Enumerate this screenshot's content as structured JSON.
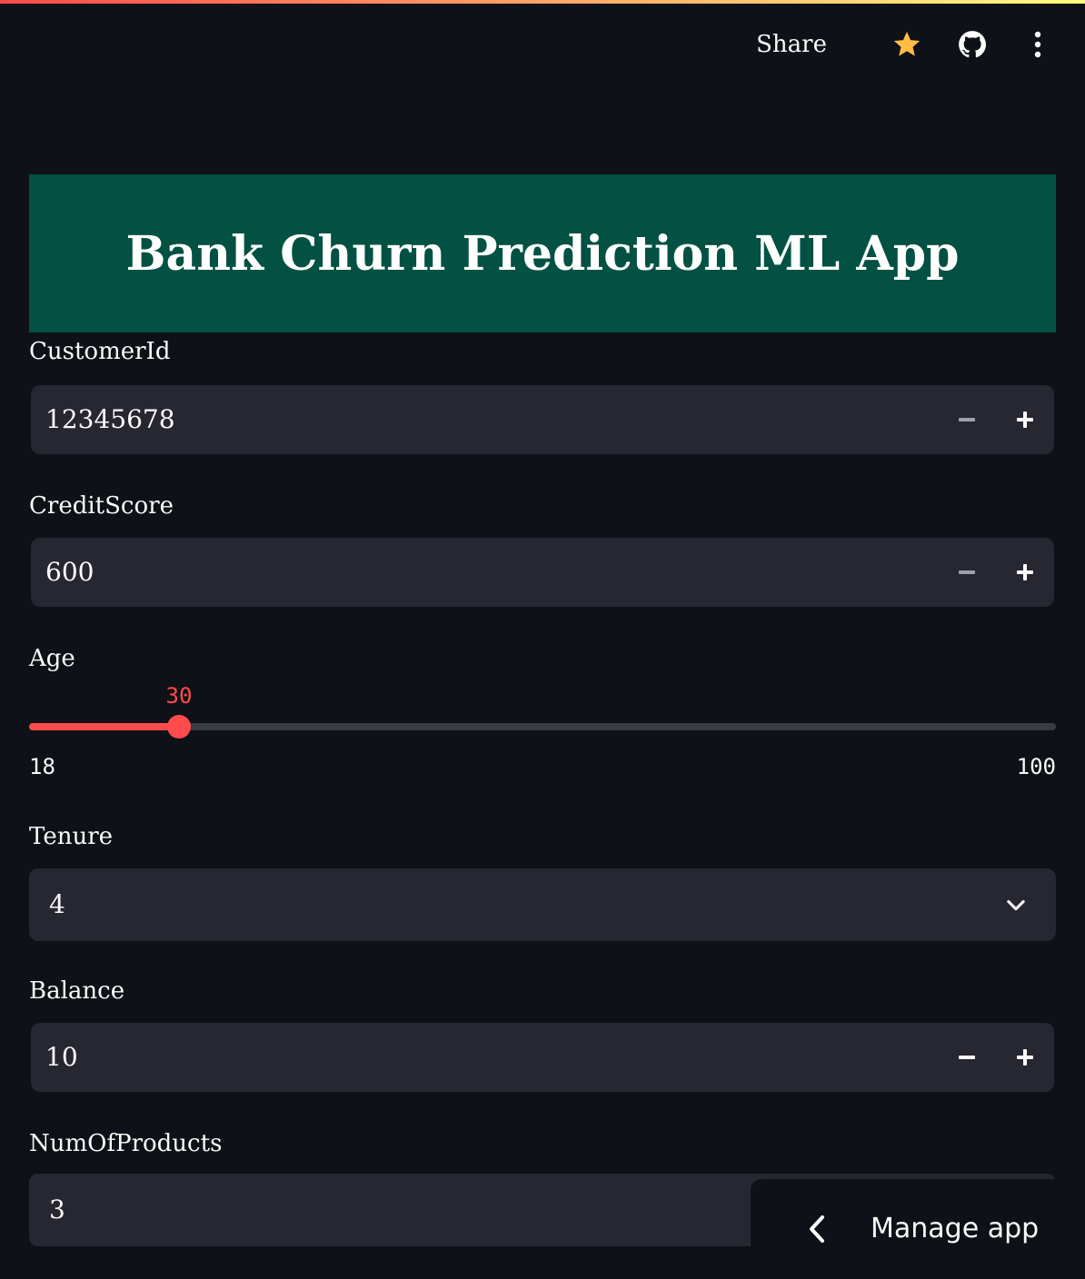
{
  "header": {
    "share_label": "Share",
    "icons": [
      "star-icon",
      "github-icon",
      "kebab-menu-icon"
    ],
    "accent_star": "#ffbd45"
  },
  "banner": {
    "title": "Bank Churn Prediction ML App",
    "background": "#025143"
  },
  "fields": {
    "customer_id": {
      "label": "CustomerId",
      "value": "12345678"
    },
    "credit_score": {
      "label": "CreditScore",
      "value": "600"
    },
    "age": {
      "label": "Age",
      "value": 30,
      "value_text": "30",
      "min": 18,
      "min_text": "18",
      "max": 100,
      "max_text": "100"
    },
    "tenure": {
      "label": "Tenure",
      "value": "4"
    },
    "balance": {
      "label": "Balance",
      "value": "10"
    },
    "num_of_products": {
      "label": "NumOfProducts",
      "value": "3"
    }
  },
  "manage_app": {
    "label": "Manage app"
  },
  "colors": {
    "primary": "#ff4b4b",
    "background": "#0e1117",
    "input_bg": "#262730"
  }
}
